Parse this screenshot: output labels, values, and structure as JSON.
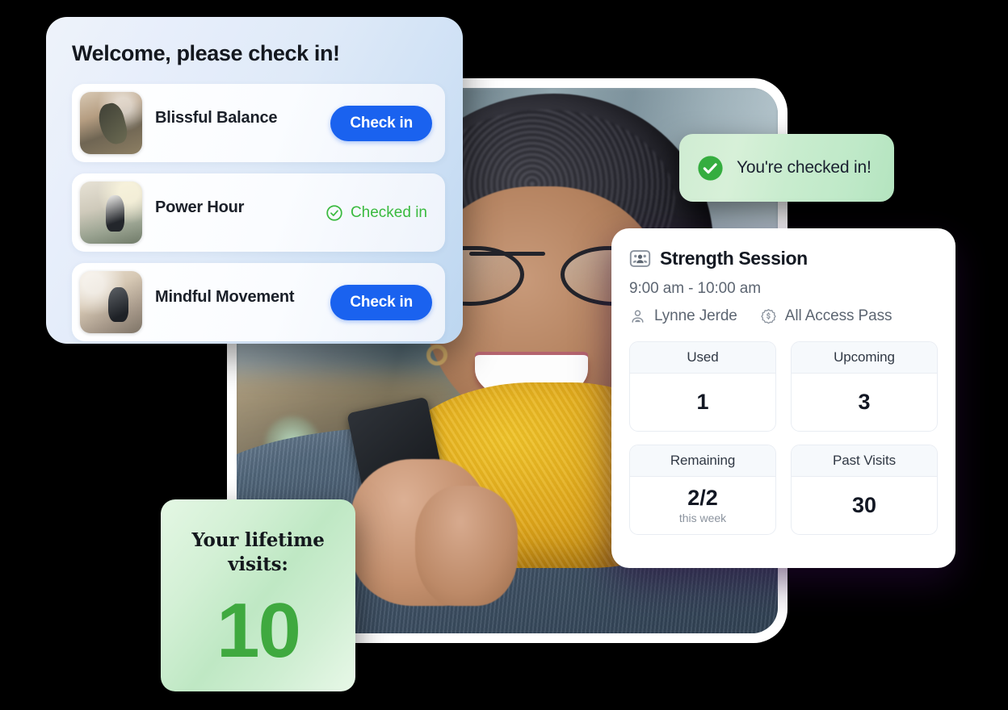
{
  "checkin_panel": {
    "title": "Welcome, please check in!",
    "classes": [
      {
        "name": "Blissful Balance",
        "action_label": "Check in",
        "status": "pending",
        "thumb_icon": "yoga-stretch-photo"
      },
      {
        "name": "Power Hour",
        "action_label": "Checked in",
        "status": "checked-in",
        "thumb_icon": "meditation-group-photo"
      },
      {
        "name": "Mindful Movement",
        "action_label": "Check in",
        "status": "pending",
        "thumb_icon": "studio-yoga-photo"
      }
    ]
  },
  "toast": {
    "icon": "check-circle-filled-icon",
    "message": "You're checked in!"
  },
  "session_card": {
    "icon": "group-class-icon",
    "title": "Strength Session",
    "time": "9:00 am - 10:00 am",
    "instructor": {
      "icon": "person-icon",
      "name": "Lynne Jerde"
    },
    "membership": {
      "icon": "pass-badge-icon",
      "name": "All Access Pass"
    },
    "stats": [
      {
        "label": "Used",
        "value": "1",
        "sub": ""
      },
      {
        "label": "Upcoming",
        "value": "3",
        "sub": ""
      },
      {
        "label": "Remaining",
        "value": "2/2",
        "sub": "this week"
      },
      {
        "label": "Past Visits",
        "value": "30",
        "sub": ""
      }
    ]
  },
  "lifetime_card": {
    "label": "Your lifetime visits:",
    "value": "10"
  },
  "hero_photo": {
    "alt": "smiling woman with glasses and yellow scarf holding a phone"
  },
  "colors": {
    "primary_blue": "#1a62ef",
    "success_green": "#3aba3f",
    "lifetime_green": "#3fa93f",
    "text_dark": "#14181f",
    "text_muted": "#5d6672"
  }
}
